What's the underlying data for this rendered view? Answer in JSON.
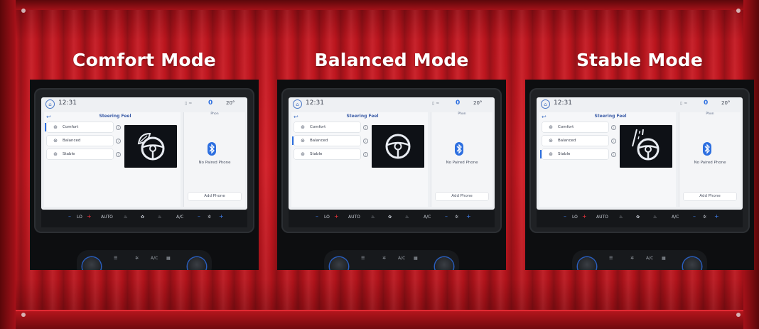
{
  "page": {
    "background_color": "#c3161f"
  },
  "panels": [
    {
      "title": "Comfort Mode",
      "selected_option": "Comfort",
      "preview_icon": "leaf-steering-wheel-icon"
    },
    {
      "title": "Balanced Mode",
      "selected_option": "Balanced",
      "preview_icon": "steering-wheel-icon"
    },
    {
      "title": "Stable Mode",
      "selected_option": "Stable",
      "preview_icon": "road-steering-wheel-icon"
    }
  ],
  "screen": {
    "time": "12:31",
    "status_zero": "0",
    "status_temp": "20°",
    "header_title": "Steering Feel",
    "options": [
      "Comfort",
      "Balanced",
      "Stable"
    ],
    "phone_label": "Phon",
    "no_phone": "No Paired Phone",
    "add_phone": "Add Phone",
    "accent_color": "#2d6fe0"
  },
  "climate_bar": {
    "lo": "LO",
    "auto": "AUTO",
    "ac": "A/C"
  },
  "console": {
    "ac": "A/C"
  }
}
